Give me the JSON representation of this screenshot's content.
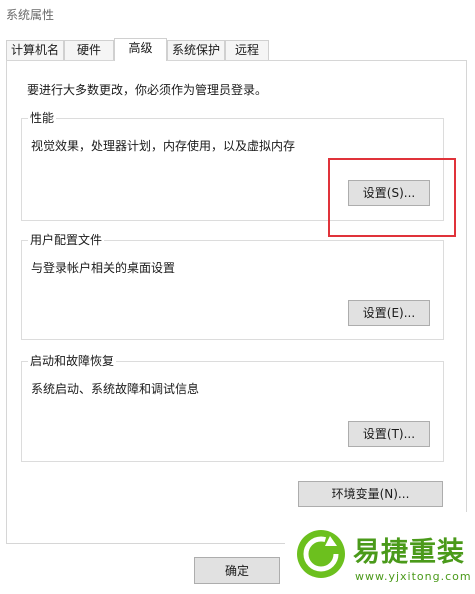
{
  "window": {
    "title": "系统属性"
  },
  "tabs": [
    {
      "label": "计算机名",
      "active": false
    },
    {
      "label": "硬件",
      "active": false
    },
    {
      "label": "高级",
      "active": true
    },
    {
      "label": "系统保护",
      "active": false
    },
    {
      "label": "远程",
      "active": false
    }
  ],
  "notice": "要进行大多数更改，你必须作为管理员登录。",
  "performance": {
    "title": "性能",
    "description": "视觉效果，处理器计划，内存使用，以及虚拟内存",
    "button": "设置(S)..."
  },
  "user_profiles": {
    "title": "用户配置文件",
    "description": "与登录帐户相关的桌面设置",
    "button": "设置(E)..."
  },
  "startup_recovery": {
    "title": "启动和故障恢复",
    "description": "系统启动、系统故障和调试信息",
    "button": "设置(T)..."
  },
  "env_button": "环境变量(N)...",
  "ok_button": "确定",
  "watermark": {
    "name": "易捷重装",
    "url": "www.yjxitong.com"
  },
  "colors": {
    "highlight": "#e0333a",
    "watermark_green": "#6cc01e"
  }
}
